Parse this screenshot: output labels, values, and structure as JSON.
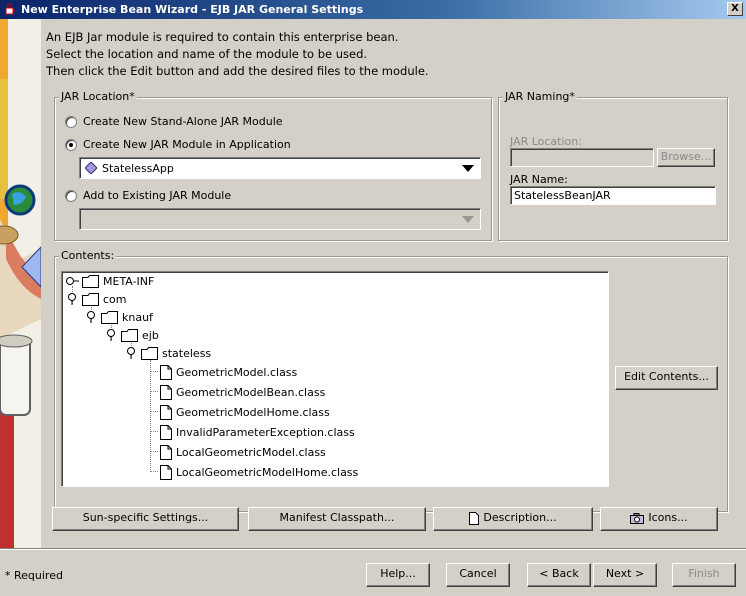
{
  "window": {
    "title": "New Enterprise Bean Wizard - EJB JAR General Settings",
    "close_glyph": "X"
  },
  "intro": {
    "line1": "An EJB Jar module is required to contain this enterprise bean.",
    "line2": "Select the location and name of the module to be used.",
    "line3": "Then click the Edit button and add the desired files to the module."
  },
  "jar_location": {
    "label": "JAR Location*",
    "option_standalone": "Create New Stand-Alone JAR Module",
    "option_in_app": "Create New JAR Module in Application",
    "app_combo_value": "StatelessApp",
    "option_existing": "Add to Existing JAR Module",
    "existing_combo_value": "",
    "selected": "option_in_app"
  },
  "jar_naming": {
    "label": "JAR Naming*",
    "location_label": "JAR Location:",
    "location_value": "",
    "browse_label": "Browse...",
    "name_label": "JAR Name:",
    "name_value": "StatelessBeanJAR"
  },
  "contents": {
    "label": "Contents:",
    "tree": [
      {
        "label": "META-INF",
        "type": "folder"
      },
      {
        "label": "com",
        "type": "folder"
      },
      {
        "label": "knauf",
        "type": "folder"
      },
      {
        "label": "ejb",
        "type": "folder"
      },
      {
        "label": "stateless",
        "type": "folder"
      },
      {
        "label": "GeometricModel.class",
        "type": "file"
      },
      {
        "label": "GeometricModelBean.class",
        "type": "file"
      },
      {
        "label": "GeometricModelHome.class",
        "type": "file"
      },
      {
        "label": "InvalidParameterException.class",
        "type": "file"
      },
      {
        "label": "LocalGeometricModel.class",
        "type": "file"
      },
      {
        "label": "LocalGeometricModelHome.class",
        "type": "file"
      }
    ],
    "edit_button": "Edit Contents..."
  },
  "settings_buttons": {
    "sun_specific": "Sun-specific Settings...",
    "manifest": "Manifest Classpath...",
    "description": "Description...",
    "icons": "Icons..."
  },
  "footer": {
    "required_note": "* Required",
    "help": "Help...",
    "cancel": "Cancel",
    "back": "< Back",
    "next": "Next >",
    "finish": "Finish"
  },
  "colors": {
    "titlebar_start": "#0a246a",
    "titlebar_end": "#a6caf0",
    "window_bg": "#d4d0c8"
  }
}
